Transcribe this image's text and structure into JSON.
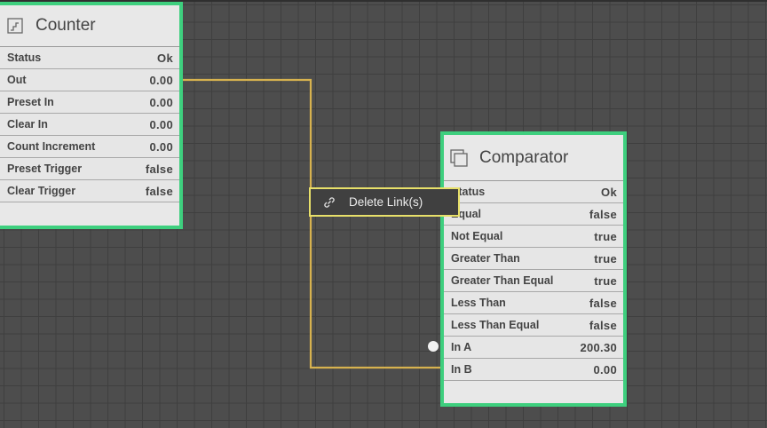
{
  "colors": {
    "canvas": "#4d4d4d",
    "node_border": "#3ecf7e",
    "link": "#d7b24f",
    "menu_border": "#e8e06a"
  },
  "counter": {
    "title": "Counter",
    "icon": "counter-icon",
    "rows": [
      {
        "label": "Status",
        "value": "Ok"
      },
      {
        "label": "Out",
        "value": "0.00"
      },
      {
        "label": "Preset In",
        "value": "0.00"
      },
      {
        "label": "Clear In",
        "value": "0.00"
      },
      {
        "label": "Count Increment",
        "value": "0.00"
      },
      {
        "label": "Preset Trigger",
        "value": "false"
      },
      {
        "label": "Clear Trigger",
        "value": "false"
      }
    ]
  },
  "comparator": {
    "title": "Comparator",
    "icon": "comparator-icon",
    "rows": [
      {
        "label": "Status",
        "value": "Ok"
      },
      {
        "label": "Equal",
        "value": "false"
      },
      {
        "label": "Not Equal",
        "value": "true"
      },
      {
        "label": "Greater Than",
        "value": "true"
      },
      {
        "label": "Greater Than Equal",
        "value": "true"
      },
      {
        "label": "Less Than",
        "value": "false"
      },
      {
        "label": "Less Than Equal",
        "value": "false"
      },
      {
        "label": "In A",
        "value": "200.30"
      },
      {
        "label": "In B",
        "value": "0.00"
      }
    ]
  },
  "context_menu": {
    "icon": "unlink-icon",
    "item_label": "Delete Link(s)"
  }
}
